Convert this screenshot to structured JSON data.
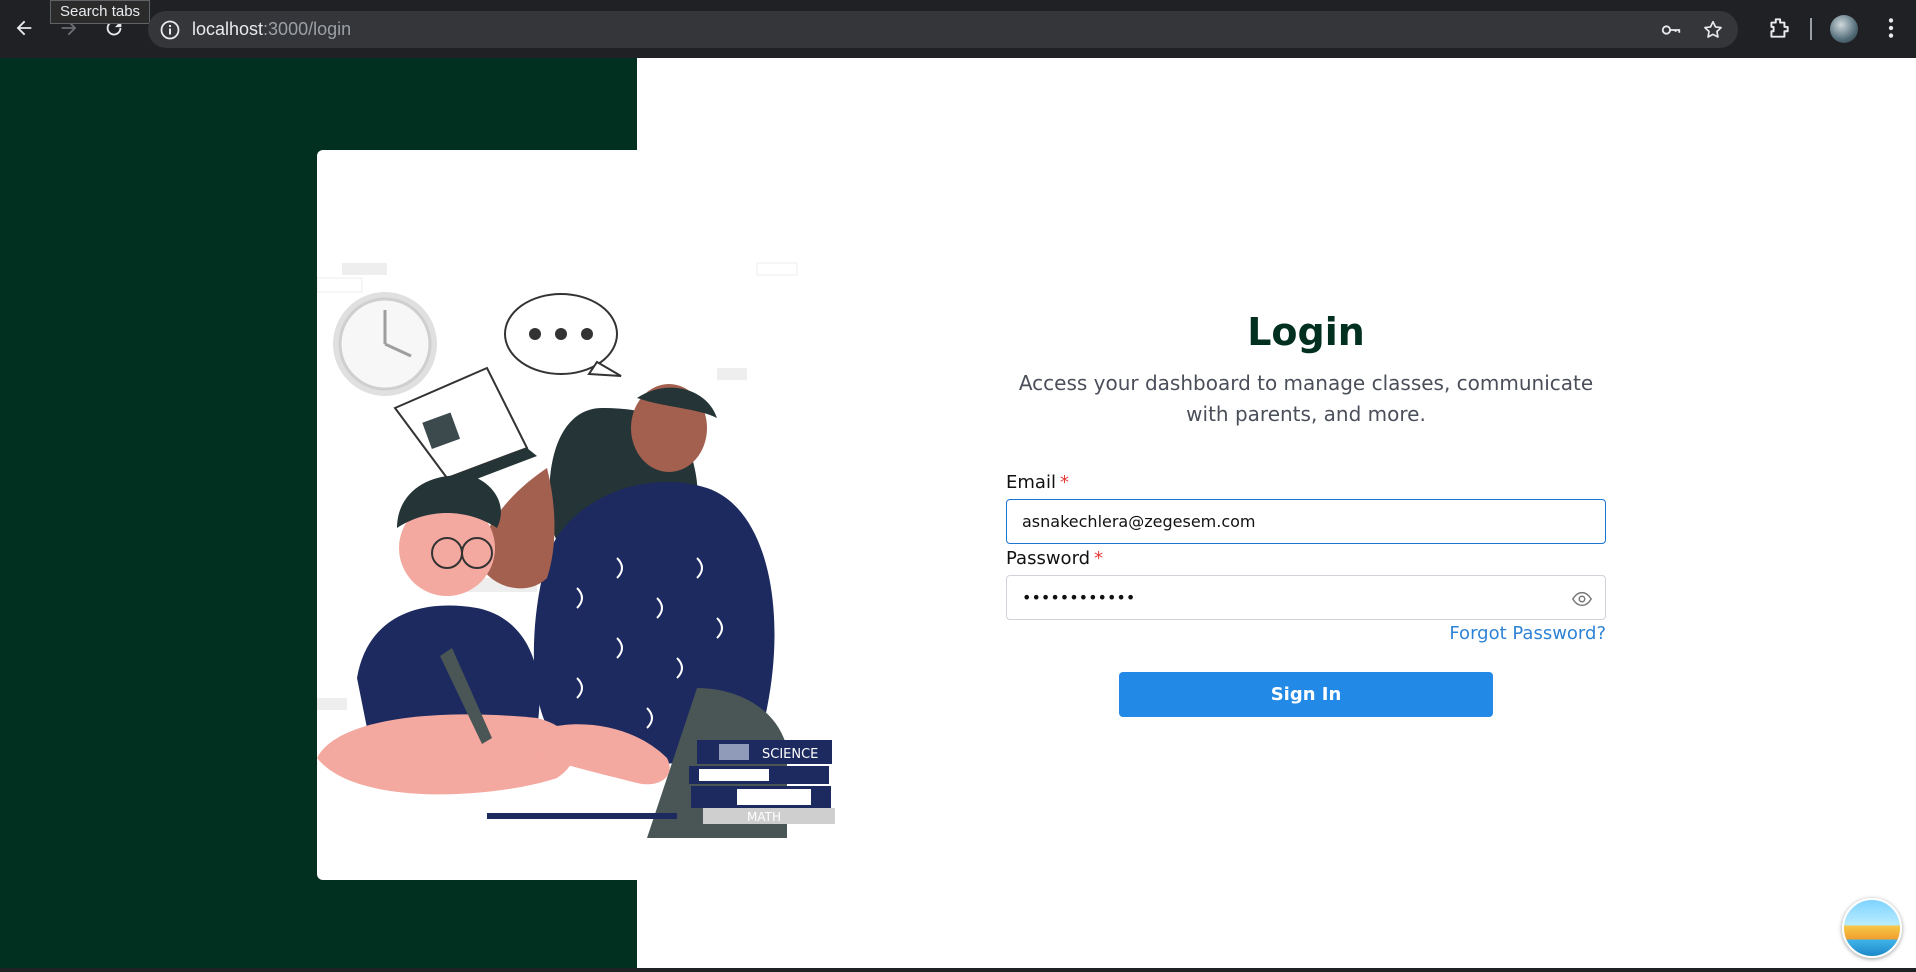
{
  "browser": {
    "tooltip": "Search tabs",
    "url_host": "localhost",
    "url_path": ":3000/login"
  },
  "login": {
    "title": "Login",
    "subtitle": "Access your dashboard to manage classes, communicate with parents, and more.",
    "email_label": "Email",
    "email_value": "asnakechlera@zegesem.com",
    "password_label": "Password",
    "password_value": "••••••••••••",
    "required_mark": "*",
    "forgot_label": "Forgot Password?",
    "signin_label": "Sign In"
  },
  "illustration": {
    "book_science": "SCIENCE",
    "book_math": "MATH"
  },
  "colors": {
    "brand_dark": "#023020",
    "accent": "#2389e6",
    "link": "#2f83d6"
  }
}
